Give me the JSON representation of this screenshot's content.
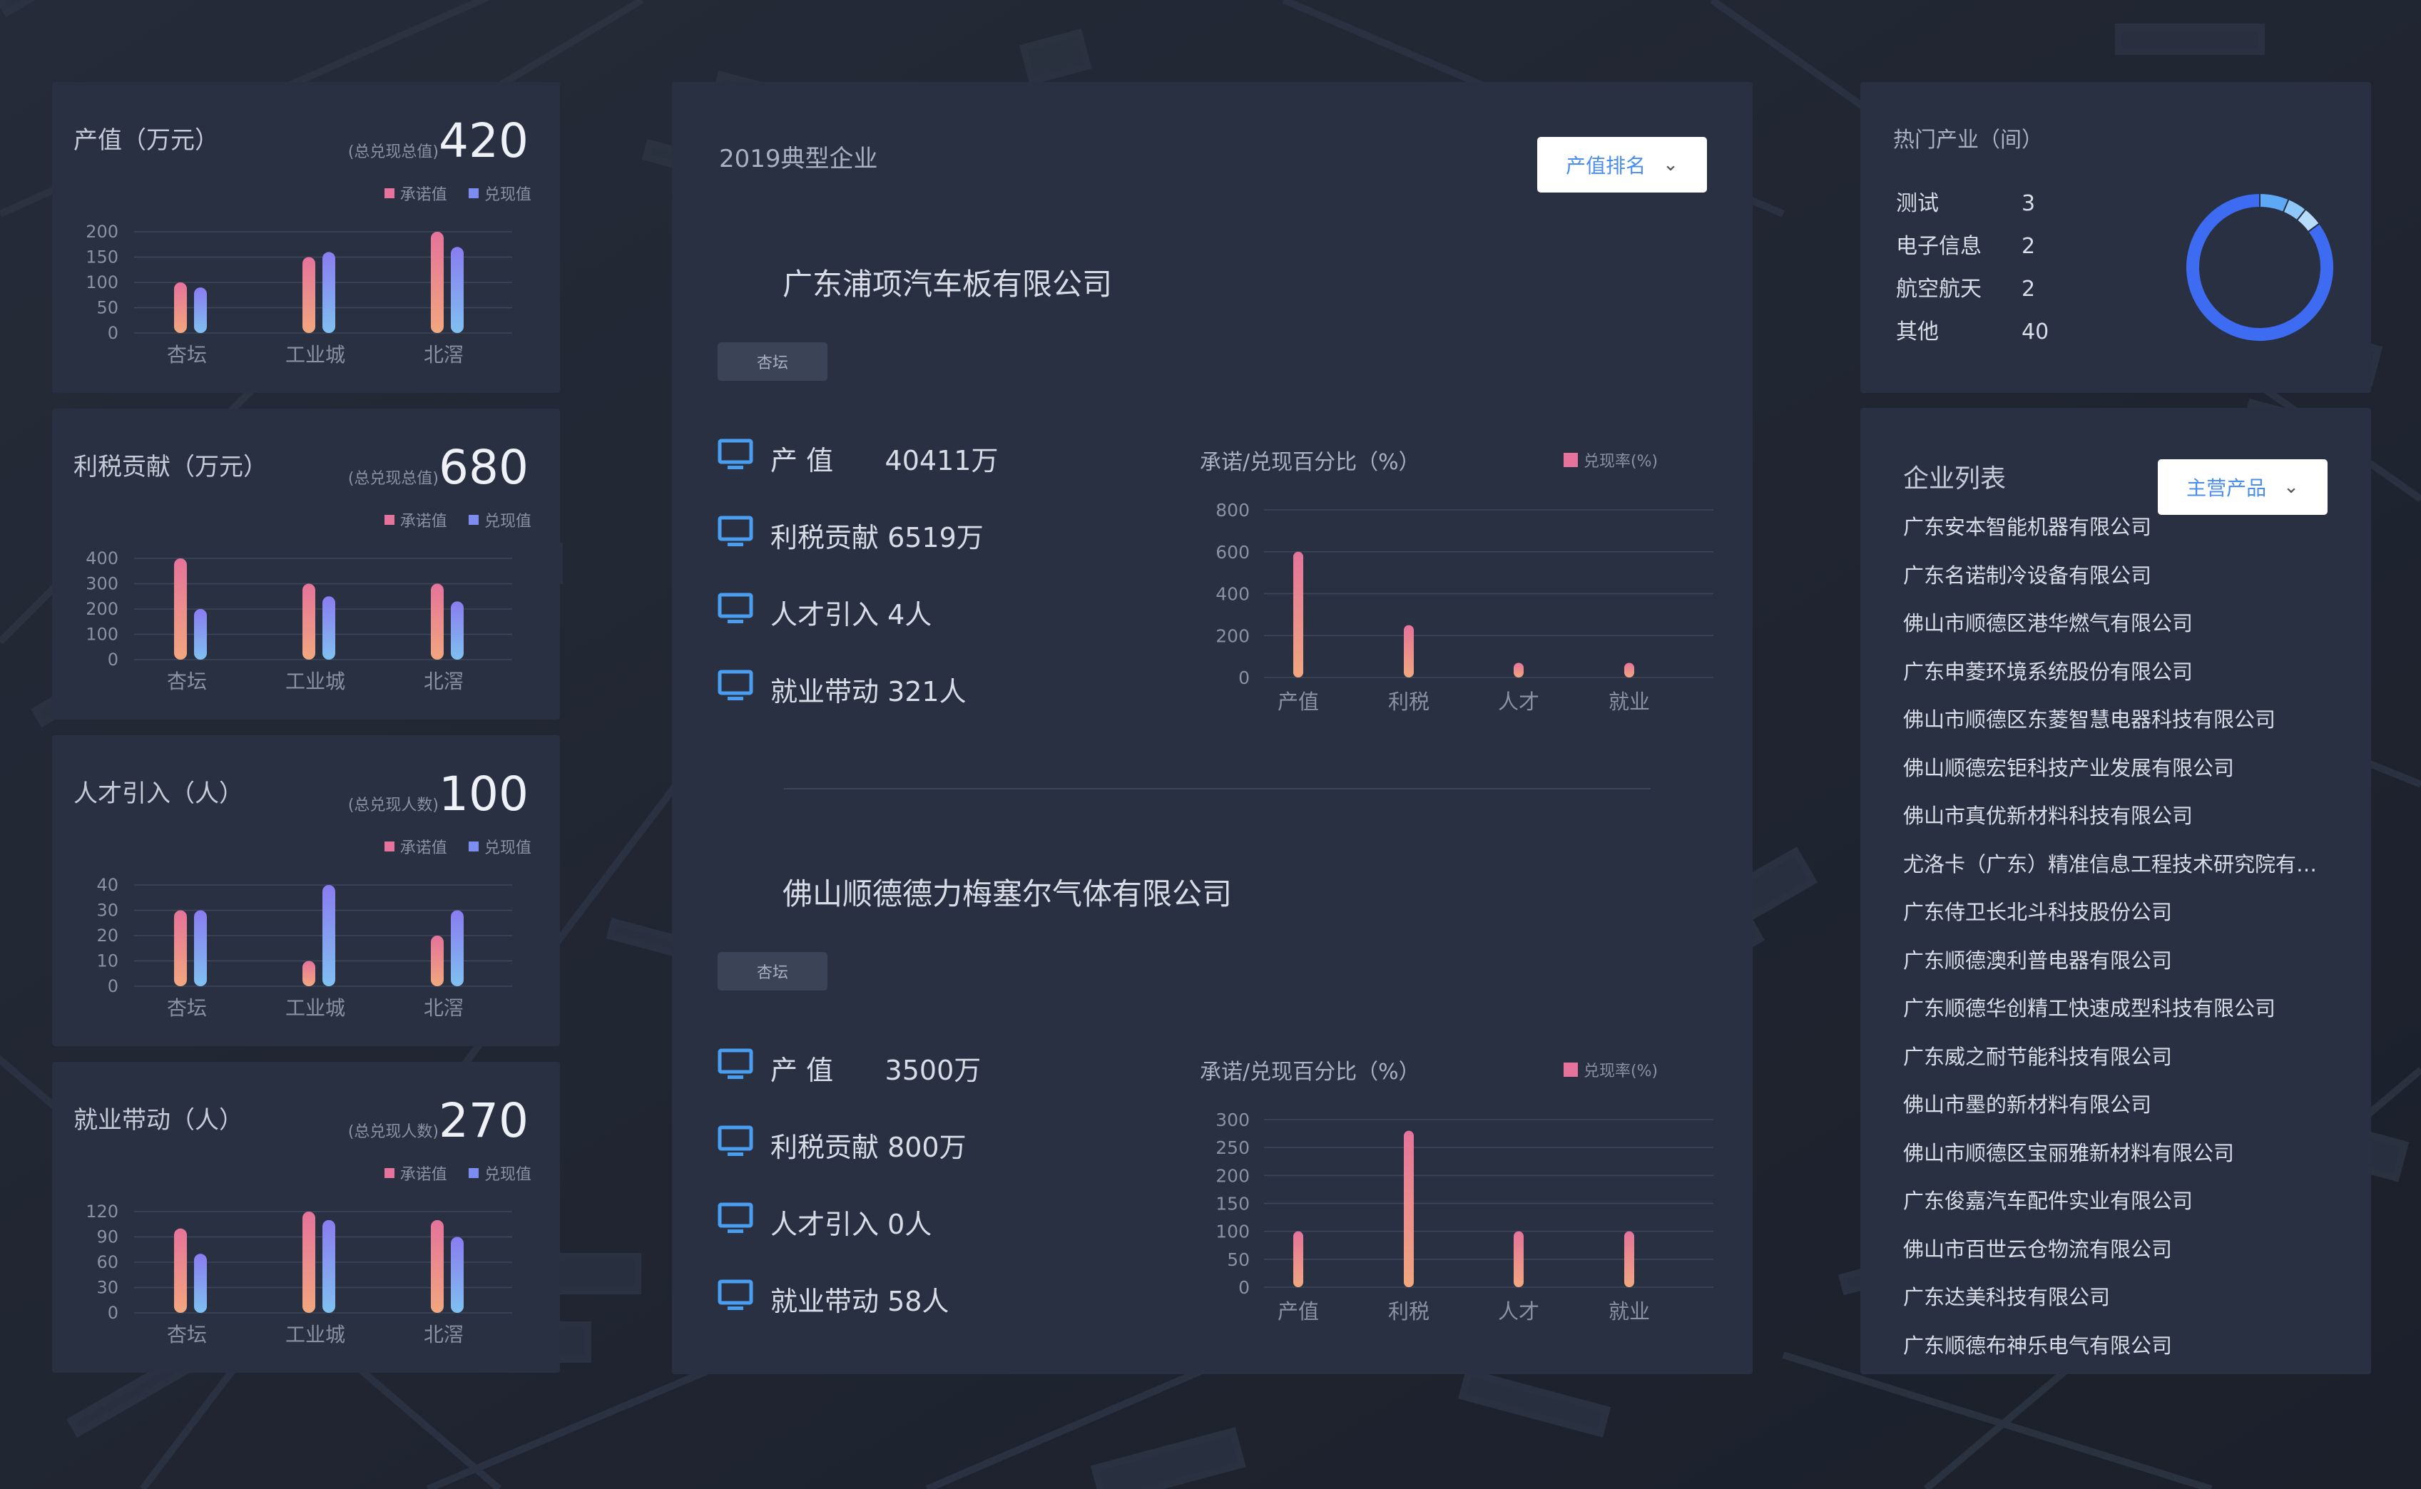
{
  "colors": {
    "bg": "#1f2533",
    "card": "#283042",
    "pink": "#e5739b",
    "blue": "#7d8cf0",
    "accent": "#4a8df0",
    "donut": "#3d6cf2"
  },
  "left_cards": [
    {
      "title": "产值（万元）",
      "sub": "(总兑现总值)",
      "value": "420",
      "legend": [
        "承诺值",
        "兑现值"
      ],
      "chart_data": {
        "type": "bar",
        "categories": [
          "杏坛",
          "工业城",
          "北滘"
        ],
        "yticks": [
          "0",
          "50",
          "100",
          "150",
          "200"
        ],
        "ylim": [
          0,
          200
        ],
        "series": [
          {
            "name": "承诺值",
            "values": [
              100,
              150,
              200
            ]
          },
          {
            "name": "兑现值",
            "values": [
              90,
              160,
              170
            ]
          }
        ]
      }
    },
    {
      "title": "利税贡献（万元）",
      "sub": "(总兑现总值)",
      "value": "680",
      "legend": [
        "承诺值",
        "兑现值"
      ],
      "chart_data": {
        "type": "bar",
        "categories": [
          "杏坛",
          "工业城",
          "北滘"
        ],
        "yticks": [
          "0",
          "100",
          "200",
          "300",
          "400"
        ],
        "ylim": [
          0,
          400
        ],
        "series": [
          {
            "name": "承诺值",
            "values": [
              400,
              300,
              300
            ]
          },
          {
            "name": "兑现值",
            "values": [
              200,
              250,
              230
            ]
          }
        ]
      }
    },
    {
      "title": "人才引入（人）",
      "sub": "(总兑现人数)",
      "value": "100",
      "legend": [
        "承诺值",
        "兑现值"
      ],
      "chart_data": {
        "type": "bar",
        "categories": [
          "杏坛",
          "工业城",
          "北滘"
        ],
        "yticks": [
          "0",
          "10",
          "20",
          "30",
          "40"
        ],
        "ylim": [
          0,
          40
        ],
        "series": [
          {
            "name": "承诺值",
            "values": [
              30,
              10,
              20
            ]
          },
          {
            "name": "兑现值",
            "values": [
              30,
              40,
              30
            ]
          }
        ]
      }
    },
    {
      "title": "就业带动（人）",
      "sub": "(总兑现人数)",
      "value": "270",
      "legend": [
        "承诺值",
        "兑现值"
      ],
      "chart_data": {
        "type": "bar",
        "categories": [
          "杏坛",
          "工业城",
          "北滘"
        ],
        "yticks": [
          "0",
          "30",
          "60",
          "90",
          "120"
        ],
        "ylim": [
          0,
          120
        ],
        "series": [
          {
            "name": "承诺值",
            "values": [
              100,
              120,
              110
            ]
          },
          {
            "name": "兑现值",
            "values": [
              70,
              110,
              90
            ]
          }
        ]
      }
    }
  ],
  "center": {
    "header": "2019典型企业",
    "dropdown": "产值排名",
    "companies": [
      {
        "name": "广东浦项汽车板有限公司",
        "tag": "杏坛",
        "metrics": [
          "产 值      40411万",
          "利税贡献 6519万",
          "人才引入 4人",
          "就业带动 321人"
        ],
        "chart_title": "承诺/兑现百分比（%）",
        "legend": "兑现率(%)",
        "chart_data": {
          "type": "bar",
          "categories": [
            "产值",
            "利税",
            "人才",
            "就业"
          ],
          "values": [
            600,
            250,
            70,
            70
          ],
          "yticks": [
            "0",
            "200",
            "400",
            "600",
            "800"
          ],
          "ylim": [
            0,
            800
          ]
        }
      },
      {
        "name": "佛山顺德德力梅塞尔气体有限公司",
        "tag": "杏坛",
        "metrics": [
          "产 值      3500万",
          "利税贡献 800万",
          "人才引入 0人",
          "就业带动 58人"
        ],
        "chart_title": "承诺/兑现百分比（%）",
        "legend": "兑现率(%)",
        "chart_data": {
          "type": "bar",
          "categories": [
            "产值",
            "利税",
            "人才",
            "就业"
          ],
          "values": [
            100,
            280,
            100,
            100
          ],
          "yticks": [
            "0",
            "50",
            "100",
            "150",
            "200",
            "250",
            "300"
          ],
          "ylim": [
            0,
            300
          ]
        }
      }
    ]
  },
  "hot": {
    "title": "热门产业（间）",
    "items": [
      {
        "name": "测试",
        "count": "3"
      },
      {
        "name": "电子信息",
        "count": "2"
      },
      {
        "name": "航空航天",
        "count": "2"
      },
      {
        "name": "其他",
        "count": "40"
      }
    ]
  },
  "company_list": {
    "title": "企业列表",
    "dropdown": "主营产品",
    "items": [
      "广东安本智能机器有限公司",
      "广东名诺制冷设备有限公司",
      "佛山市顺德区港华燃气有限公司",
      "广东申菱环境系统股份有限公司",
      "佛山市顺德区东菱智慧电器科技有限公司",
      "佛山顺德宏钜科技产业发展有限公司",
      "佛山市真优新材料科技有限公司",
      "尤洛卡（广东）精准信息工程技术研究院有限公司",
      "广东侍卫长北斗科技股份公司",
      "广东顺德澳利普电器有限公司",
      "广东顺德华创精工快速成型科技有限公司",
      "广东威之耐节能科技有限公司",
      "佛山市墨的新材料有限公司",
      "佛山市顺德区宝丽雅新材料有限公司",
      "广东俊嘉汽车配件实业有限公司",
      "佛山市百世云仓物流有限公司",
      "广东达美科技有限公司",
      "广东顺德布神乐电气有限公司"
    ]
  }
}
